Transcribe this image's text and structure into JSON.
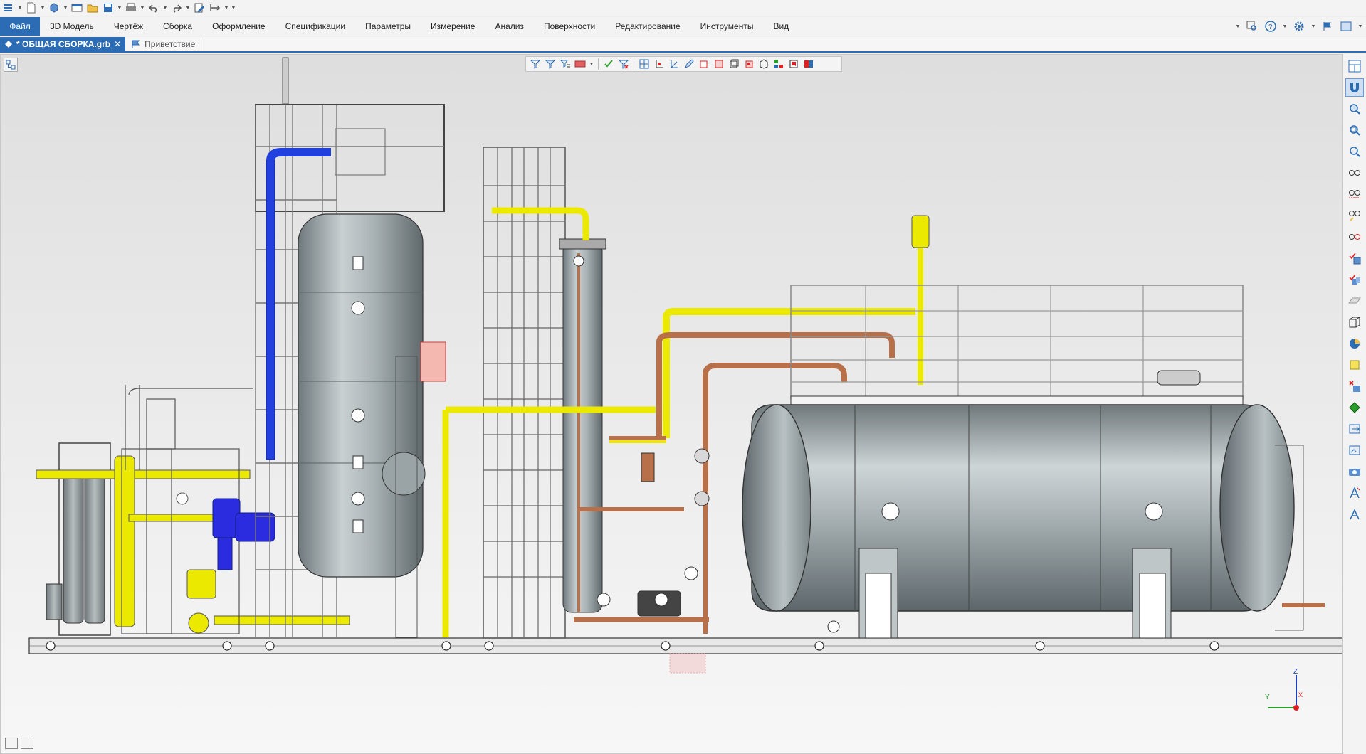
{
  "menu": {
    "file": "Файл",
    "items": [
      "3D Модель",
      "Чертёж",
      "Сборка",
      "Оформление",
      "Спецификации",
      "Параметры",
      "Измерение",
      "Анализ",
      "Поверхности",
      "Редактирование",
      "Инструменты",
      "Вид"
    ]
  },
  "tabs": {
    "active": "* ОБЩАЯ СБОРКА.grb",
    "close_glyph": "✕",
    "welcome": "Приветствие"
  },
  "axis": {
    "z": "Z",
    "y": "Y",
    "x": "X"
  },
  "colors": {
    "accent": "#2b6cb4",
    "pipe_yellow": "#f2e600",
    "pipe_blue": "#1f3fd6",
    "pipe_copper": "#b8704a",
    "vessel": "#9ea8ab",
    "frame": "#b9b9b9"
  },
  "icons": {
    "qat": [
      "menu-icon",
      "new-file-icon",
      "model-icon",
      "window-icon",
      "open-folder-icon",
      "save-icon",
      "print-icon",
      "undo-icon",
      "redo-icon",
      "edit-icon",
      "measure-icon"
    ],
    "filter_toolbar": [
      "filter-icon",
      "filter-edit-icon",
      "filter-list-icon",
      "selection-color-icon",
      "check-filter-icon",
      "clear-filter-icon",
      "grid-icon",
      "axis-icon",
      "coordinate-icon",
      "pencil-icon",
      "view-front-icon",
      "view-back-icon",
      "view-left-icon",
      "view-right-icon",
      "view-iso-icon",
      "hierarchy-icon",
      "bookmark-icon",
      "section-icon"
    ],
    "right_toolbar": [
      "window-layout-icon",
      "magnet-icon",
      "zoom-icon",
      "zoom-window-icon",
      "zoom-fit-icon",
      "glasses-icon",
      "glasses-cut-icon",
      "glasses-edit-icon",
      "glasses-view-icon",
      "check-cube-icon",
      "check-cubes-icon",
      "plane-icon",
      "box-outline-icon",
      "pie-icon",
      "yellow-box-icon",
      "red-x-box-icon",
      "green-box-icon",
      "export-icon",
      "import-icon",
      "camera-icon",
      "text-icon",
      "text-style-icon"
    ]
  }
}
